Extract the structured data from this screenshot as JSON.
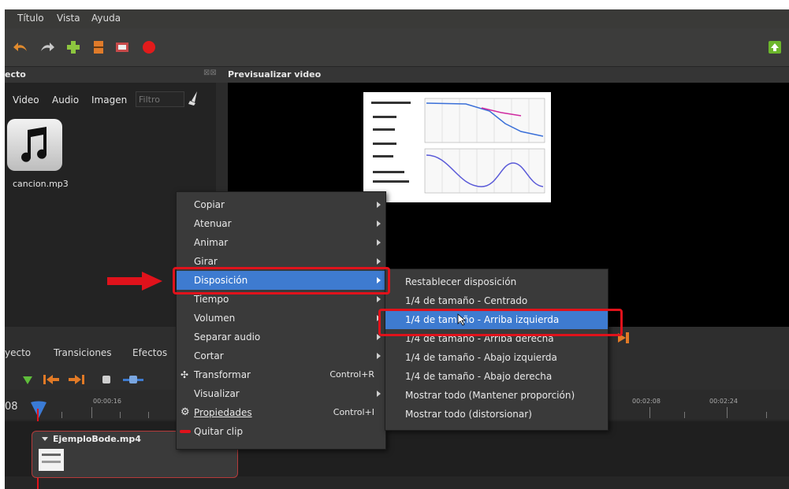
{
  "menubar": {
    "items": [
      "Título",
      "Vista",
      "Ayuda"
    ]
  },
  "panels": {
    "project_title": "ecto",
    "preview_title": "Previsualizar video",
    "tabs": [
      "Video",
      "Audio",
      "Imagen"
    ],
    "filter_placeholder": "Filtro"
  },
  "files": [
    {
      "name": "cancion.mp3",
      "icon": "music-note-icon"
    }
  ],
  "context_menu": {
    "items": [
      {
        "label": "Copiar",
        "submenu": true,
        "shortcut": ""
      },
      {
        "label": "Atenuar",
        "submenu": true,
        "shortcut": ""
      },
      {
        "label": "Animar",
        "submenu": true,
        "shortcut": ""
      },
      {
        "label": "Girar",
        "submenu": true,
        "shortcut": ""
      },
      {
        "label": "Disposición",
        "submenu": true,
        "shortcut": ""
      },
      {
        "label": "Tiempo",
        "submenu": true,
        "shortcut": ""
      },
      {
        "label": "Volumen",
        "submenu": true,
        "shortcut": ""
      },
      {
        "label": "Separar audio",
        "submenu": true,
        "shortcut": ""
      },
      {
        "label": "Cortar",
        "submenu": true,
        "shortcut": ""
      },
      {
        "label": "Transformar",
        "submenu": false,
        "shortcut": "Control+R"
      },
      {
        "label": "Visualizar",
        "submenu": true,
        "shortcut": ""
      },
      {
        "label": "Propiedades",
        "submenu": false,
        "shortcut": "Control+I"
      },
      {
        "label": "Quitar clip",
        "submenu": false,
        "shortcut": ""
      }
    ]
  },
  "submenu": {
    "items": [
      "Restablecer disposición",
      "1/4 de tamaño - Centrado",
      "1/4 de tamaño - Arriba izquierda",
      "1/4 de tamaño - Arriba derecha",
      "1/4 de tamaño - Abajo izquierda",
      "1/4 de tamaño - Abajo derecha",
      "Mostrar todo (Mantener proporción)",
      "Mostrar todo (distorsionar)"
    ]
  },
  "lower_tabs": [
    "yecto",
    "Transiciones",
    "Efectos"
  ],
  "timeline": {
    "ticks": [
      "00:00:16",
      "00:02:08",
      "00:02:24"
    ],
    "left_label": "08",
    "clip_name": "EjemploBode.mp4"
  },
  "colors": {
    "highlight": "#3e7bd0",
    "annotation": "#e0121b"
  }
}
